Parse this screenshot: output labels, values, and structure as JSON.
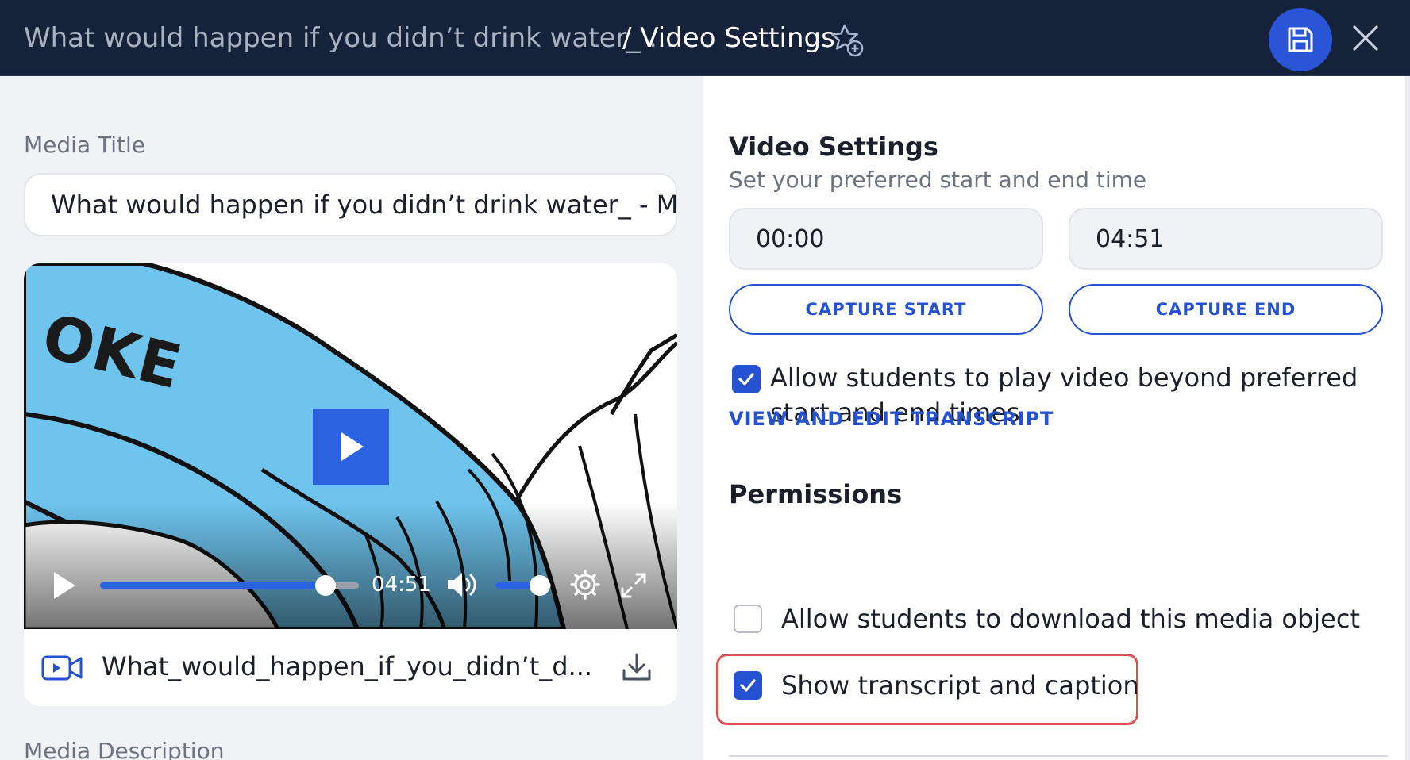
{
  "header": {
    "breadcrumb_parent": "What would happen if you didn’t drink water_ ...",
    "breadcrumb_current": "/ Video Settings"
  },
  "left": {
    "media_title_label": "Media Title",
    "media_title_value": "What would happen if you didn’t drink water_ - M",
    "player": {
      "duration": "04:51",
      "progress_fraction": 0.87,
      "volume_fraction": 0.8,
      "art_text": "OKE"
    },
    "file_name": "What_would_happen_if_you_didn’t_d...",
    "media_description_label": "Media Description"
  },
  "right": {
    "heading": "Video Settings",
    "subheading": "Set your preferred start and end time",
    "start_time": "00:00",
    "end_time": "04:51",
    "capture_start_label": "CAPTURE START",
    "capture_end_label": "CAPTURE END",
    "allow_beyond": {
      "checked": true,
      "line1": "Allow students to play video beyond preferred",
      "line2": "start and end times"
    },
    "view_transcript_label": "VIEW AND EDIT TRANSCRIPT",
    "permissions_heading": "Permissions",
    "allow_download": {
      "checked": false,
      "label": "Allow students to download this media object"
    },
    "show_transcript": {
      "checked": true,
      "label": "Show transcript and caption"
    }
  },
  "colors": {
    "header_bg": "#15223a",
    "accent": "#2452d0",
    "video_blue": "#6fc4ee",
    "highlight": "#d9534f"
  }
}
